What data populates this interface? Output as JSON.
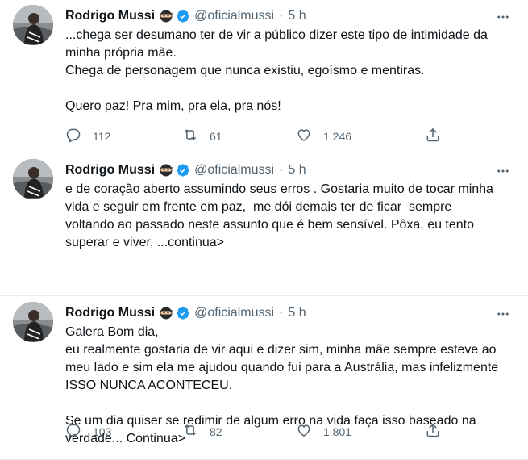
{
  "tweets": [
    {
      "author": {
        "name": "Rodrigo Mussi",
        "handle": "@oficialmussi",
        "time": "5 h"
      },
      "lines": [
        "...chega ser desumano ter de vir a público dizer este tipo de intimidade da",
        "minha própria mãe.",
        "Chega de personagem que nunca existiu, egoísmo e mentiras.",
        "",
        "Quero paz! Pra mim, pra ela, pra nós!"
      ],
      "stats": {
        "replies": "112",
        "retweets": "61",
        "likes": "1.246"
      }
    },
    {
      "author": {
        "name": "Rodrigo Mussi",
        "handle": "@oficialmussi",
        "time": "5 h"
      },
      "lines": [
        "e de coração aberto assumindo seus erros . Gostaria muito de tocar minha",
        "vida e seguir em frente em paz,  me dói demais ter de ficar  sempre",
        "voltando ao passado neste assunto que é bem sensível. Pôxa, eu tento",
        "superar e viver, ...continua>"
      ],
      "stats": {
        "replies": "103",
        "retweets": "82",
        "likes": "1.801"
      }
    },
    {
      "author": {
        "name": "Rodrigo Mussi",
        "handle": "@oficialmussi",
        "time": "5 h"
      },
      "lines": [
        "Galera Bom dia,",
        "eu realmente gostaria de vir aqui e dizer sim, minha mãe sempre esteve ao",
        "meu lado e sim ela me ajudou quando fui para a Austrália, mas infelizmente",
        "ISSO NUNCA ACONTECEU.",
        "",
        "Se um dia quiser se redimir de algum erro na vida faça isso baseado na",
        "verdade... Continua>"
      ],
      "stats": null
    }
  ],
  "colors": {
    "verified": "#1d9bf0",
    "muted": "#536471",
    "text": "#0f1419",
    "divider": "#e6ecf0"
  },
  "icons": {
    "emoji": "ninja-emoji",
    "verified": "verified-badge-icon"
  }
}
